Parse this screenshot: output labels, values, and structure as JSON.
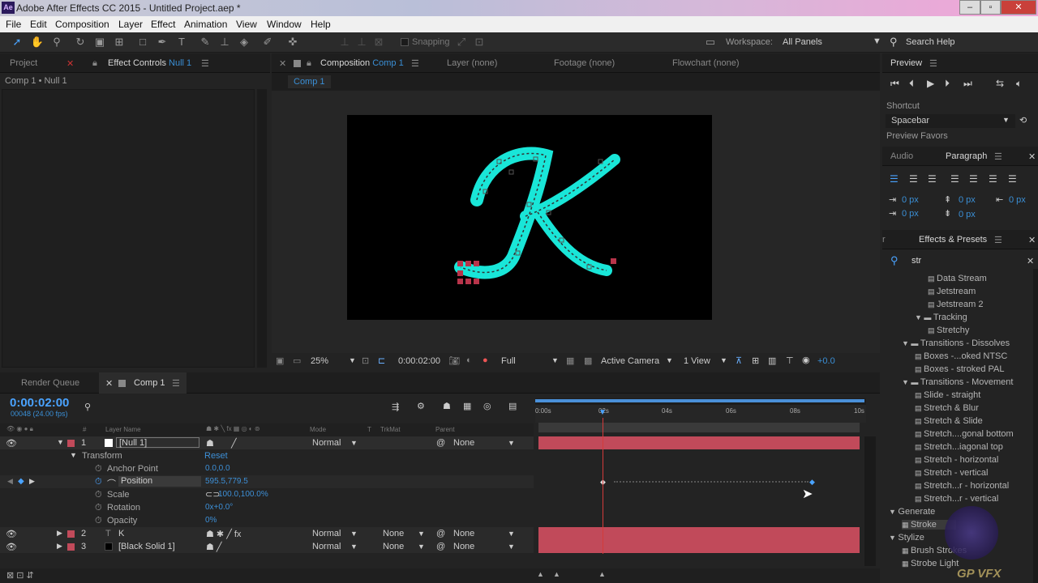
{
  "app": {
    "title": "Adobe After Effects CC 2015 - Untitled Project.aep *",
    "logo": "Ae"
  },
  "menu": [
    "File",
    "Edit",
    "Composition",
    "Layer",
    "Effect",
    "Animation",
    "View",
    "Window",
    "Help"
  ],
  "toolbar": {
    "snapping": "Snapping",
    "workspace_label": "Workspace:",
    "workspace_value": "All Panels",
    "search_help": "Search Help"
  },
  "left_panel": {
    "tab_project": "Project",
    "tab_effect_controls": "Effect Controls",
    "effect_controls_target": "Null 1",
    "breadcrumb": "Comp 1 • Null 1"
  },
  "comp_panel": {
    "tab_composition": "Composition",
    "comp_name": "Comp 1",
    "tab_layer": "Layer (none)",
    "tab_footage": "Footage (none)",
    "tab_flowchart": "Flowchart (none)",
    "subtab": "Comp 1",
    "zoom": "25%",
    "timecode": "0:00:02:00",
    "resolution": "Full",
    "camera": "Active Camera",
    "views": "1 View",
    "exposure": "+0.0"
  },
  "preview": {
    "title": "Preview",
    "shortcut_label": "Shortcut",
    "shortcut_value": "Spacebar",
    "favors": "Preview Favors"
  },
  "paragraph": {
    "tab_audio": "Audio",
    "tab_paragraph": "Paragraph",
    "indent_values": [
      "0 px",
      "0 px",
      "0 px",
      "0 px",
      "0 px"
    ]
  },
  "effects": {
    "title": "Effects & Presets",
    "search": "str",
    "items": [
      {
        "label": "Data Stream",
        "type": "item",
        "level": 3
      },
      {
        "label": "Jetstream",
        "type": "item",
        "level": 3
      },
      {
        "label": "Jetstream 2",
        "type": "item",
        "level": 3
      },
      {
        "label": "Tracking",
        "type": "folder",
        "level": 2
      },
      {
        "label": "Stretchy",
        "type": "item",
        "level": 3
      },
      {
        "label": "Transitions - Dissolves",
        "type": "folder",
        "level": 1
      },
      {
        "label": "Boxes -...oked NTSC",
        "type": "item",
        "level": 2
      },
      {
        "label": "Boxes - stroked PAL",
        "type": "item",
        "level": 2
      },
      {
        "label": "Transitions - Movement",
        "type": "folder",
        "level": 1
      },
      {
        "label": "Slide - straight",
        "type": "item",
        "level": 2
      },
      {
        "label": "Stretch & Blur",
        "type": "item",
        "level": 2
      },
      {
        "label": "Stretch & Slide",
        "type": "item",
        "level": 2
      },
      {
        "label": "Stretch....gonal bottom",
        "type": "item",
        "level": 2
      },
      {
        "label": "Stretch...iagonal top",
        "type": "item",
        "level": 2
      },
      {
        "label": "Stretch - horizontal",
        "type": "item",
        "level": 2
      },
      {
        "label": "Stretch - vertical",
        "type": "item",
        "level": 2
      },
      {
        "label": "Stretch...r - horizontal",
        "type": "item",
        "level": 2
      },
      {
        "label": "Stretch...r - vertical",
        "type": "item",
        "level": 2
      },
      {
        "label": "Generate",
        "type": "category",
        "level": 0
      },
      {
        "label": "Stroke",
        "type": "effect",
        "level": 1
      },
      {
        "label": "Stylize",
        "type": "category",
        "level": 0
      },
      {
        "label": "Brush Strokes",
        "type": "effect",
        "level": 1
      },
      {
        "label": "Strobe Light",
        "type": "effect",
        "level": 1
      }
    ]
  },
  "timeline": {
    "tab_render": "Render Queue",
    "tab_comp": "Comp 1",
    "timecode": "0:00:02:00",
    "frames": "00048 (24.00 fps)",
    "headers": {
      "layer_name": "Layer Name",
      "mode": "Mode",
      "t": "T",
      "trkmat": "TrkMat",
      "parent": "Parent"
    },
    "ruler": [
      "0:00s",
      "02s",
      "04s",
      "06s",
      "08s",
      "10s"
    ],
    "layers": [
      {
        "num": "1",
        "name": "[Null 1]",
        "mode": "Normal",
        "trkmat": "",
        "parent": "None",
        "color": "#c14a5a"
      },
      {
        "num": "2",
        "name": "K",
        "mode": "Normal",
        "trkmat": "None",
        "parent": "None",
        "color": "#c14a5a"
      },
      {
        "num": "3",
        "name": "[Black Solid 1]",
        "mode": "Normal",
        "trkmat": "None",
        "parent": "None",
        "color": "#c14a5a"
      }
    ],
    "transform": {
      "label": "Transform",
      "reset": "Reset",
      "props": [
        {
          "name": "Anchor Point",
          "value": "0.0,0.0"
        },
        {
          "name": "Position",
          "value": "595.5,779.5"
        },
        {
          "name": "Scale",
          "value": "100.0,100.0%"
        },
        {
          "name": "Rotation",
          "value": "0x+0.0°"
        },
        {
          "name": "Opacity",
          "value": "0%"
        }
      ]
    }
  },
  "watermark": "GP VFX"
}
